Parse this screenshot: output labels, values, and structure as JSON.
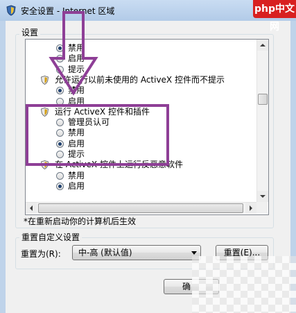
{
  "window": {
    "title": "安全设置 - Internet 区域"
  },
  "settings_group": {
    "label": "设置"
  },
  "list": {
    "rows": [
      {
        "kind": "radio",
        "label": "禁用",
        "selected": true
      },
      {
        "kind": "radio",
        "label": "启用",
        "selected": false
      },
      {
        "kind": "radio",
        "label": "提示",
        "selected": false
      },
      {
        "kind": "header",
        "label": "允许运行以前未使用的 ActiveX 控件而不提示"
      },
      {
        "kind": "radio",
        "label": "禁用",
        "selected": true
      },
      {
        "kind": "radio",
        "label": "启用",
        "selected": false
      },
      {
        "kind": "header",
        "label": "运行 ActiveX 控件和插件"
      },
      {
        "kind": "radio",
        "label": "管理员认可",
        "selected": false
      },
      {
        "kind": "radio",
        "label": "禁用",
        "selected": false
      },
      {
        "kind": "radio",
        "label": "启用",
        "selected": true
      },
      {
        "kind": "radio",
        "label": "提示",
        "selected": false
      },
      {
        "kind": "header",
        "label": "在 ActiveX 控件上运行反恶意软件"
      },
      {
        "kind": "radio",
        "label": "禁用",
        "selected": false
      },
      {
        "kind": "radio",
        "label": "启用",
        "selected": true
      }
    ]
  },
  "restart_note": "*在重新启动你的计算机后生效",
  "reset_group": {
    "label": "重置自定义设置",
    "reset_to_label": "重置为(R):",
    "level_value": "中-高 (默认值)",
    "reset_button": "重置(E)..."
  },
  "ok_button": "确",
  "watermark": "php中文网",
  "colors": {
    "highlight_box": "#8e3f96",
    "arrow": "#8e3f96"
  }
}
